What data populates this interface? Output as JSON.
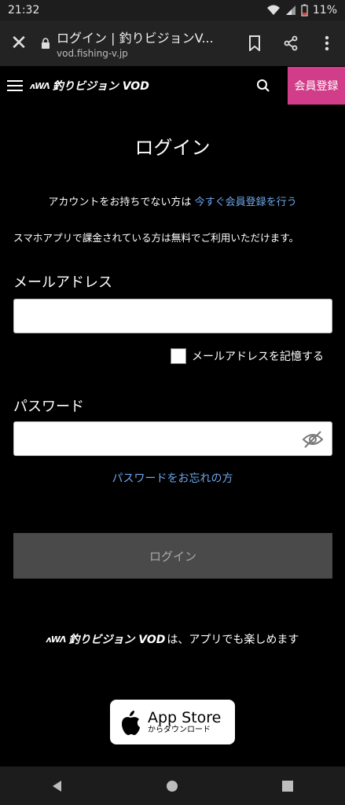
{
  "status_bar": {
    "time": "21:32",
    "battery": "11%"
  },
  "browser": {
    "tab_title": "ログイン | 釣りビジョンV...",
    "url": "vod.fishing-v.jp"
  },
  "site_header": {
    "logo_text": "釣りビジョン VOD",
    "logo_mark": "ʌWΛ",
    "register_label": "会員登録"
  },
  "login": {
    "title": "ログイン",
    "no_account_text": "アカウントをお持ちでない方は",
    "no_account_link": "今すぐ会員登録を行う",
    "app_note": "スマホアプリで課金されている方は無料でご利用いただけます。",
    "email_label": "メールアドレス",
    "email_value": "",
    "remember_label": "メールアドレスを記憶する",
    "password_label": "パスワード",
    "password_value": "",
    "forgot_link": "パスワードをお忘れの方",
    "login_button": "ログイン"
  },
  "promo": {
    "logo_text": "釣りビジョン VOD",
    "logo_mark": "ʌWΛ",
    "text": "は、アプリでも楽しめます"
  },
  "app_store": {
    "line1": "App Store",
    "line2": "からダウンロード"
  },
  "colors": {
    "accent_pink": "#d23d8a",
    "link_blue": "#6ea7ea",
    "button_gray": "#4a4a4a"
  }
}
